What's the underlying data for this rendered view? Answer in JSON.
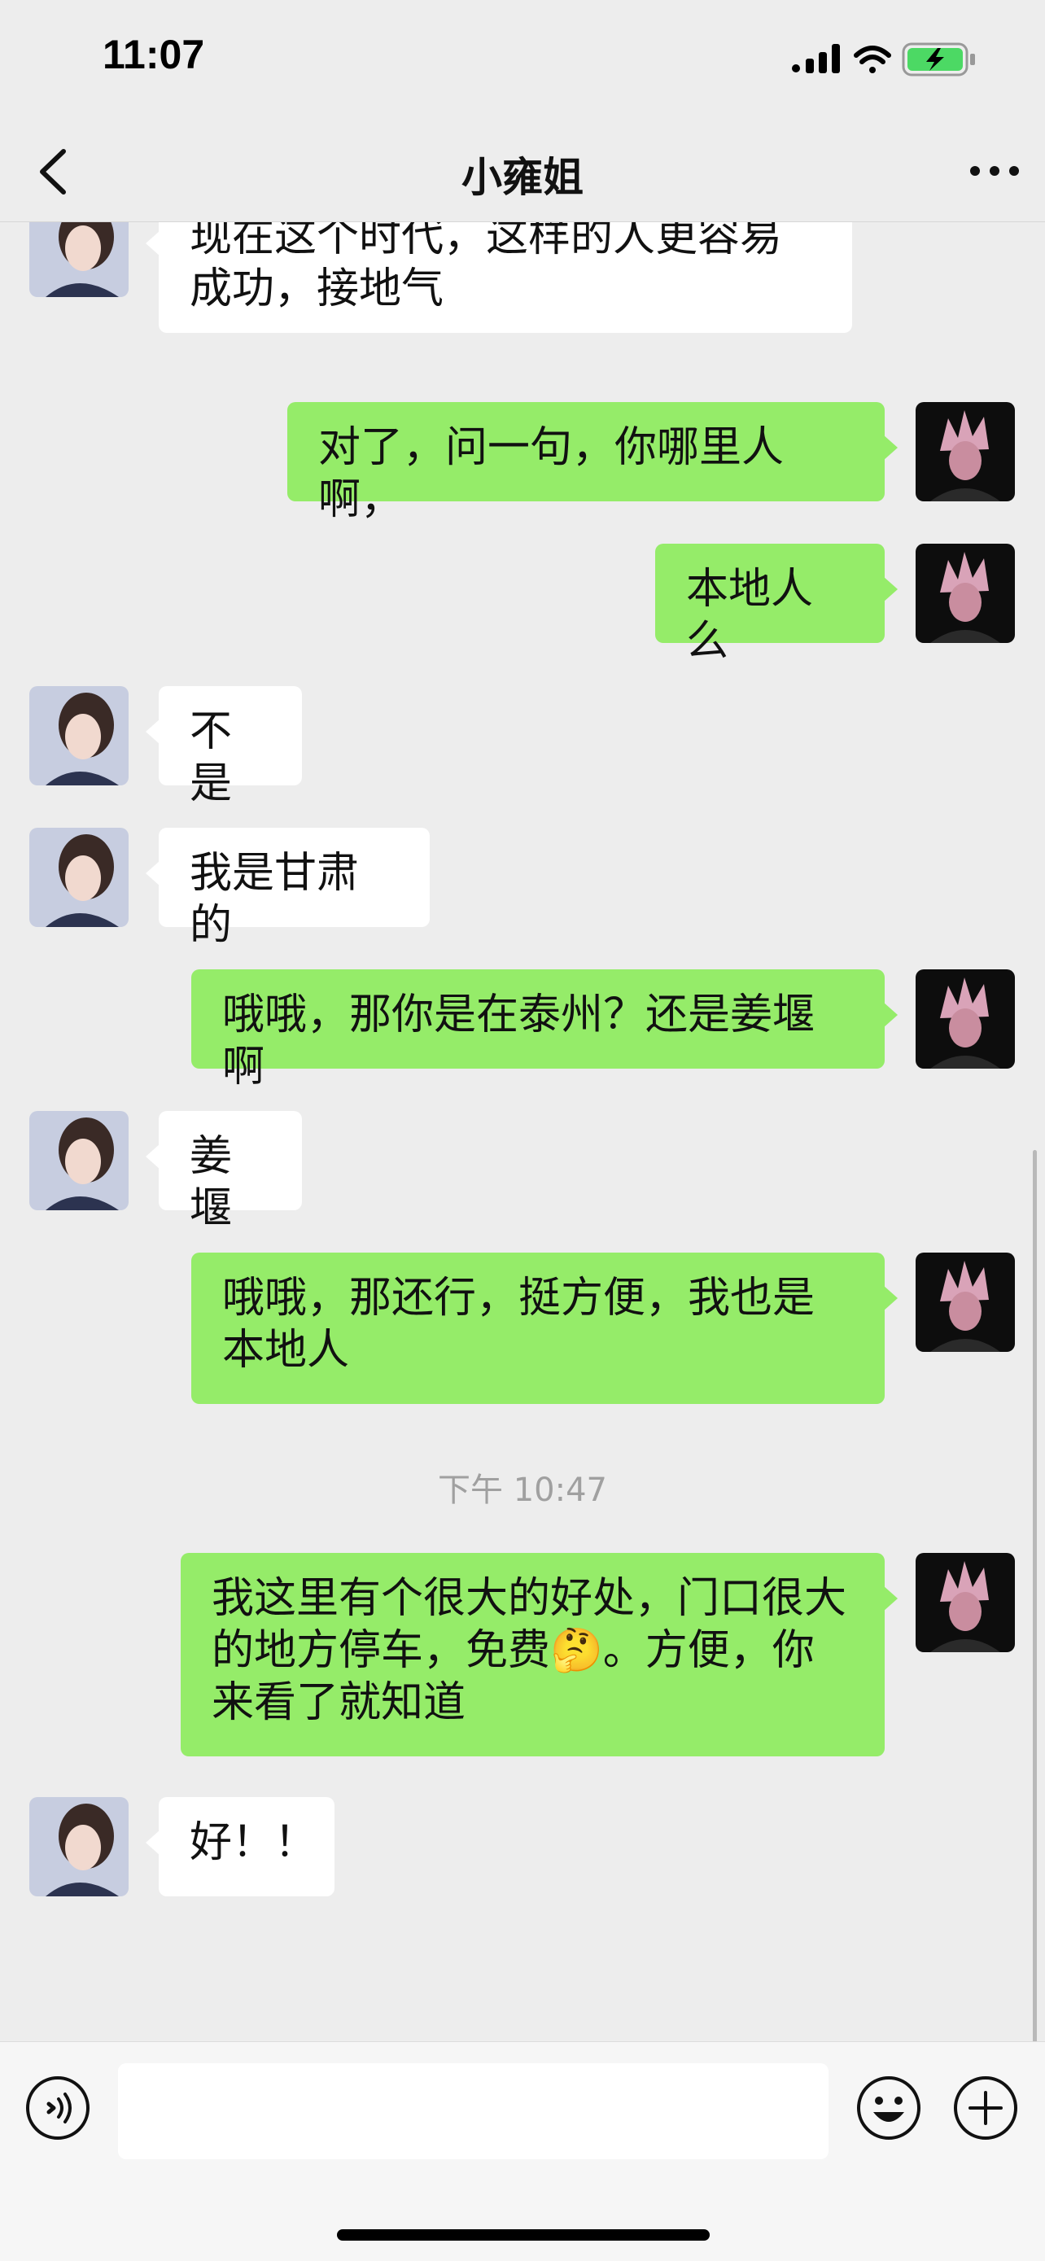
{
  "status_bar": {
    "time": "11:07"
  },
  "nav": {
    "title": "小雍姐"
  },
  "colors": {
    "background": "#ededed",
    "bubble_self": "#95ec69",
    "bubble_other": "#ffffff"
  },
  "messages": [
    {
      "sender": "other",
      "text": "现在这个时代，这样的人更容易成功，接地气"
    },
    {
      "sender": "self",
      "text": "对了，问一句，你哪里人啊，"
    },
    {
      "sender": "self",
      "text": "本地人么"
    },
    {
      "sender": "other",
      "text": "不是"
    },
    {
      "sender": "other",
      "text": "我是甘肃的"
    },
    {
      "sender": "self",
      "text": "哦哦，那你是在泰州？还是姜堰啊"
    },
    {
      "sender": "other",
      "text": "姜堰"
    },
    {
      "sender": "self",
      "text": "哦哦，那还行，挺方便，我也是本地人"
    },
    {
      "sender": "self",
      "text": "我这里有个很大的好处，门口很大的地方停车，免费🤔。方便，你来看了就知道"
    },
    {
      "sender": "other",
      "text": "好！！"
    }
  ],
  "timestamp": "下午 10:47",
  "input": {
    "value": "",
    "placeholder": ""
  },
  "icons": {
    "back": "chevron-left-icon",
    "more": "more-dots-icon",
    "voice": "voice-icon",
    "emoji": "emoji-icon",
    "plus": "plus-icon"
  }
}
